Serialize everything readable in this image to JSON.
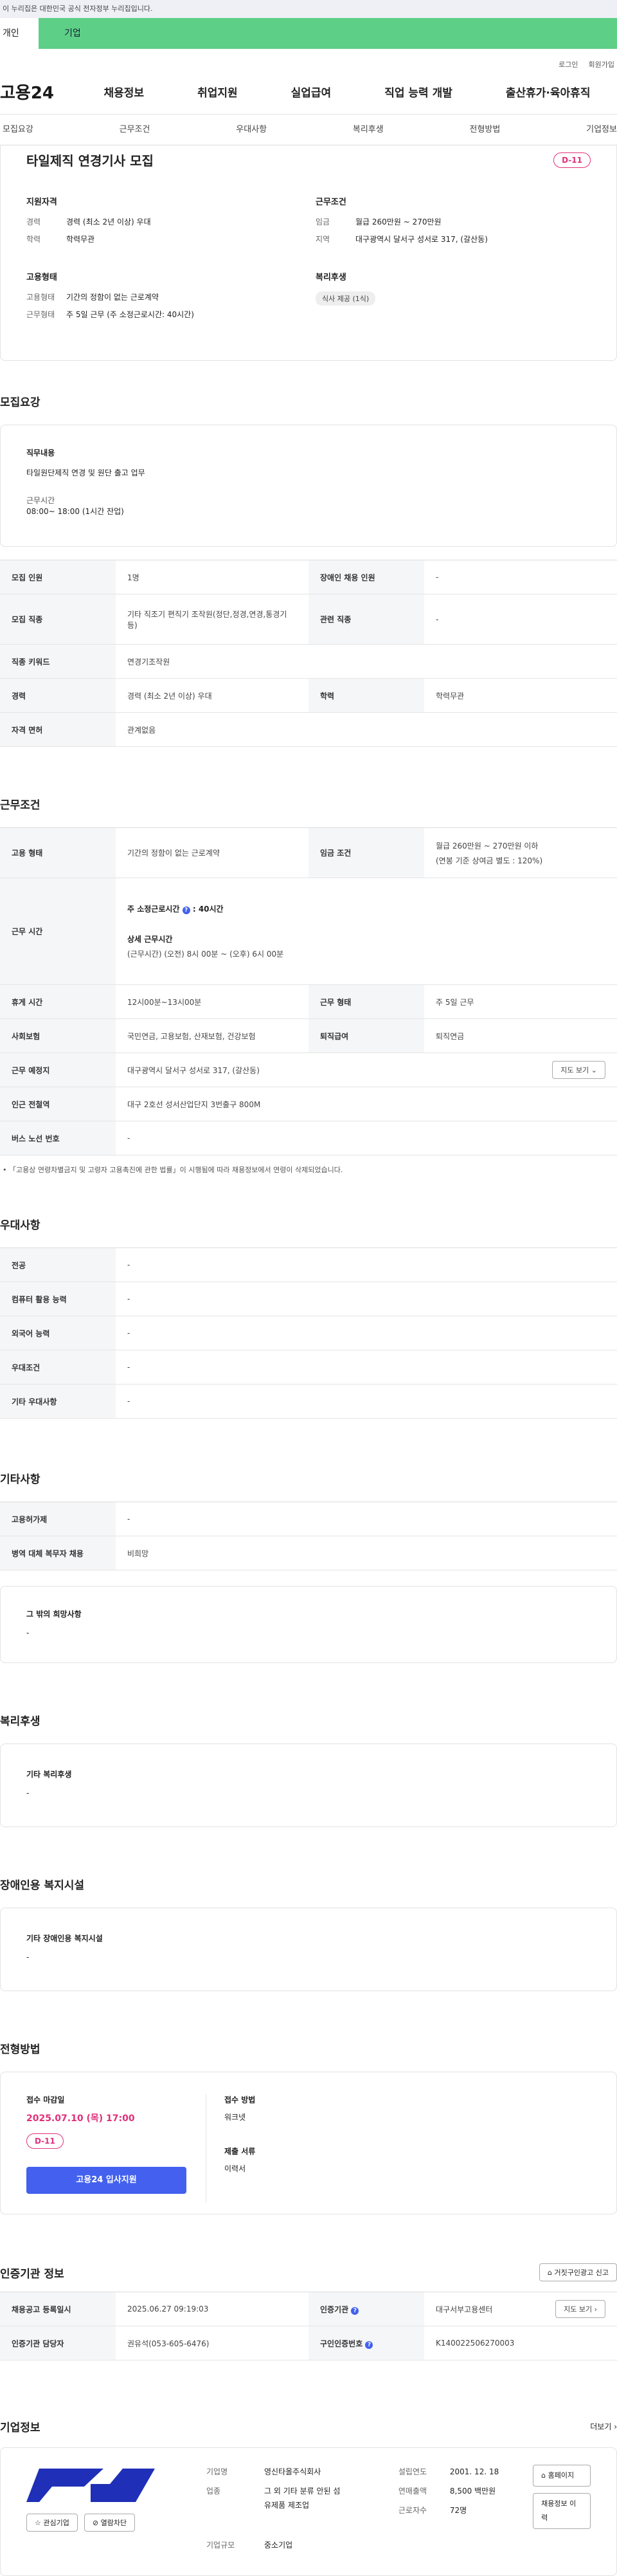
{
  "gov_banner": "이 누리집은 대한민국 공식 전자정부 누리집입니다.",
  "top_tabs": [
    "개인",
    "기업"
  ],
  "util": [
    "로그인",
    "회원가입"
  ],
  "logo": "고용24",
  "gnb": [
    "채용정보",
    "취업지원",
    "실업급여",
    "직업 능력 개발",
    "출산휴가·육아휴직"
  ],
  "snb": [
    "모집요강",
    "근무조건",
    "우대사항",
    "복리후생",
    "전형방법",
    "기업정보"
  ],
  "job": {
    "title": "타일제직 연경기사 모집",
    "dday": "D-11",
    "qual_title": "지원자격",
    "career_k": "경력",
    "career_v": "경력 (최소 2년 이상) 우대",
    "edu_k": "학력",
    "edu_v": "학력무관",
    "cond_title": "근무조건",
    "wage_k": "임금",
    "wage_v": "월급 260만원 ~ 270만원",
    "area_k": "지역",
    "area_v": "대구광역시 달서구 성서로 317, (갈산동)",
    "emp_title": "고용형태",
    "emptype_k": "고용형태",
    "emptype_v": "기간의 정함이 없는 근로계약",
    "worktype_k": "근무형태",
    "worktype_v": "주 5일 근무 (주 소정근로시간: 40시간)",
    "welfare_title": "복리후생",
    "welfare_chip": "식사 제공 (1식)"
  },
  "recruit": {
    "title": "모집요강",
    "duty_label": "직무내용",
    "duty_text": "타일원단제직 연경 및 원단 출고 업무",
    "time_label": "근무시간",
    "time_text": "08:00~ 18:00 (1시간 잔업)",
    "rows": [
      [
        "모집 인원",
        "1명",
        "장애인 채용 인원",
        "-"
      ],
      [
        "모집 직종",
        "기타 직조기 편직기 조작원(정단,정경,연경,통경기 등)",
        "관련 직종",
        "-"
      ],
      [
        "직종 키워드",
        "연경기조작원"
      ],
      [
        "경력",
        "경력 (최소 2년 이상) 우대",
        "학력",
        "학력무관"
      ],
      [
        "자격 면허",
        "관계없음"
      ]
    ]
  },
  "work": {
    "title": "근무조건",
    "type_k": "고용 형태",
    "type_v": "기간의 정함이 없는 근로계약",
    "wage_k": "임금 조건",
    "wage_v1": "월급 260만원 ~ 270만원 이하",
    "wage_v2": "(연봉 기준 상여금 별도 : 120%)",
    "hours_k": "근무 시간",
    "hours_a": "주 소정근로시간",
    "hours_b": ": 40시간",
    "hours_detail_t": "상세 근무시간",
    "hours_detail": "(근무시간) (오전) 8시 00분 ~ (오후) 6시 00분",
    "rest_k": "휴게 시간",
    "rest_v": "12시00분~13시00분",
    "form_k": "근무 형태",
    "form_v": "주 5일 근무",
    "ins_k": "사회보험",
    "ins_v": "국민연금, 고용보험, 산재보험, 건강보험",
    "ret_k": "퇴직급여",
    "ret_v": "퇴직연금",
    "place_k": "근무 예정지",
    "place_v": "대구광역시 달서구 성서로 317, (갈산동)",
    "map_btn": "지도 보기",
    "sub_k": "인근 전철역",
    "sub_v": "대구 2호선 성서산업단지 3번출구 800M",
    "bus_k": "버스 노선 번호",
    "bus_v": "-",
    "note": "「고용상 연령차별금지 및 고령자 고용촉진에 관한 법률」이 시행됨에 따라 채용정보에서 연령이 삭제되었습니다."
  },
  "pref": {
    "title": "우대사항",
    "rows": [
      [
        "전공",
        "-"
      ],
      [
        "컴퓨터 활용 능력",
        "-"
      ],
      [
        "외국어 능력",
        "-"
      ],
      [
        "우대조건",
        "-"
      ],
      [
        "기타 우대사항",
        "-"
      ]
    ]
  },
  "etc": {
    "title": "기타사항",
    "rows": [
      [
        "고용허가제",
        "-"
      ],
      [
        "병역 대체 복무자 채용",
        "비희망"
      ]
    ],
    "hope_label": "그 밖의 희망사항",
    "hope_v": "-"
  },
  "welfare": {
    "title": "복리후생",
    "label": "기타 복리후생",
    "v": "-"
  },
  "disab": {
    "title": "장애인용 복지시설",
    "label": "기타 장애인용 복지시설",
    "v": "-"
  },
  "select": {
    "title": "전형방법",
    "deadline_label": "접수 마감일",
    "deadline": "2025.07.10 (목) 17:00",
    "dday": "D-11",
    "apply_btn": "고용24 입사지원",
    "method_label": "접수 방법",
    "method_v": "워크넷",
    "docs_label": "제출 서류",
    "docs_v": "이력서"
  },
  "agency": {
    "title": "인증기관 정보",
    "report_btn": "거짓구인광고 신고",
    "rows": [
      [
        "채용공고 등록일시",
        "2025.06.27 09:19:03",
        "인증기관",
        "대구서부고용센터"
      ],
      [
        "인증기관 담당자",
        "권유석(053-605-6476)",
        "구인인증번호",
        "K140022506270003"
      ]
    ],
    "map_btn": "지도 보기"
  },
  "company": {
    "title": "기업정보",
    "more": "더보기",
    "like_btn": "관심기업",
    "block_btn": "열람차단",
    "name_k": "기업명",
    "name_v": "영신타올주식회사",
    "ind_k": "업종",
    "ind_v": "그 외 기타 분류 안된 섬유제품 제조업",
    "est_k": "설립연도",
    "est_v": "2001. 12. 18",
    "sales_k": "연매출액",
    "sales_v": "8,500 백만원",
    "emp_k": "근로자수",
    "emp_v": "72명",
    "size_k": "기업규모",
    "size_v": "중소기업",
    "home_btn": "홈페이지",
    "hist_btn": "채용정보 이력"
  }
}
